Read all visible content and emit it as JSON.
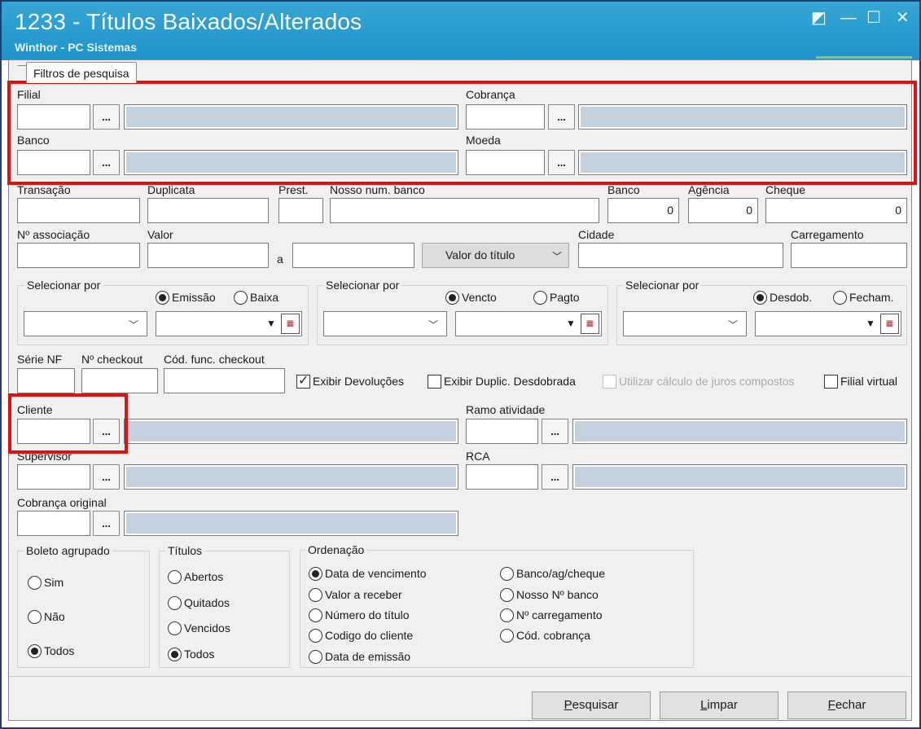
{
  "window": {
    "title": "1233 - Títulos Baixados/Alterados",
    "subtitle": "Winthor - PC Sistemas",
    "controls": [
      "restore-icon",
      "minimize-icon",
      "maximize-icon",
      "close-icon"
    ]
  },
  "tab": {
    "label": "Filtros de pesquisa"
  },
  "fields": {
    "filial": "Filial",
    "cobranca": "Cobrança",
    "banco": "Banco",
    "moeda": "Moeda",
    "transacao": "Transação",
    "duplicata": "Duplicata",
    "prest": "Prest.",
    "nosso_num": "Nosso num. banco",
    "banco2": "Banco",
    "agencia": "Agência",
    "cheque": "Cheque",
    "banco2_value": "0",
    "agencia_value": "0",
    "cheque_value": "0",
    "n_associacao": "Nº associação",
    "valor": "Valor",
    "valor_sep": "a",
    "valor_tipo": "Valor do título",
    "cidade": "Cidade",
    "carregamento": "Carregamento",
    "serie_nf": "Série NF",
    "n_checkout": "Nº checkout",
    "cod_func": "Cód. func. checkout",
    "cliente": "Cliente",
    "ramo": "Ramo atividade",
    "supervisor": "Supervisor",
    "rca": "RCA",
    "cobranca_original": "Cobrança original",
    "lookup_button": "..."
  },
  "select_groups": [
    {
      "label": "Selecionar por",
      "opt1": "Emissão",
      "opt2": "Baixa"
    },
    {
      "label": "Selecionar por",
      "opt1": "Vencto",
      "opt2": "Pagto"
    },
    {
      "label": "Selecionar por",
      "opt1": "Desdob.",
      "opt2": "Fecham."
    }
  ],
  "checks": {
    "exibir_devolucoes": "Exibir Devoluções",
    "exibir_duplic": "Exibir Duplic. Desdobrada",
    "juros": "Utilizar cálculo de juros compostos",
    "filial_virtual": "Filial virtual"
  },
  "boleto": {
    "label": "Boleto agrupado",
    "options": [
      "Sim",
      "Não",
      "Todos"
    ]
  },
  "titulos": {
    "label": "Títulos",
    "options": [
      "Abertos",
      "Quitados",
      "Vencidos",
      "Todos"
    ]
  },
  "ordenacao": {
    "label": "Ordenação",
    "left": [
      "Data de vencimento",
      "Valor a receber",
      "Número do título",
      "Codigo do cliente",
      "Data de emissão"
    ],
    "right": [
      "Banco/ag/cheque",
      "Nosso Nº banco",
      "Nº carregamento",
      "Cód. cobrança"
    ]
  },
  "buttons": {
    "pesquisar_first": "P",
    "pesquisar_rest": "esquisar",
    "limpar_first": "L",
    "limpar_rest": "impar",
    "fechar_first": "F",
    "fechar_rest": "echar"
  },
  "colors": {
    "title_bar": "#1f93c9",
    "highlight": "#e01010",
    "desc_fill": "#c3d0de"
  }
}
